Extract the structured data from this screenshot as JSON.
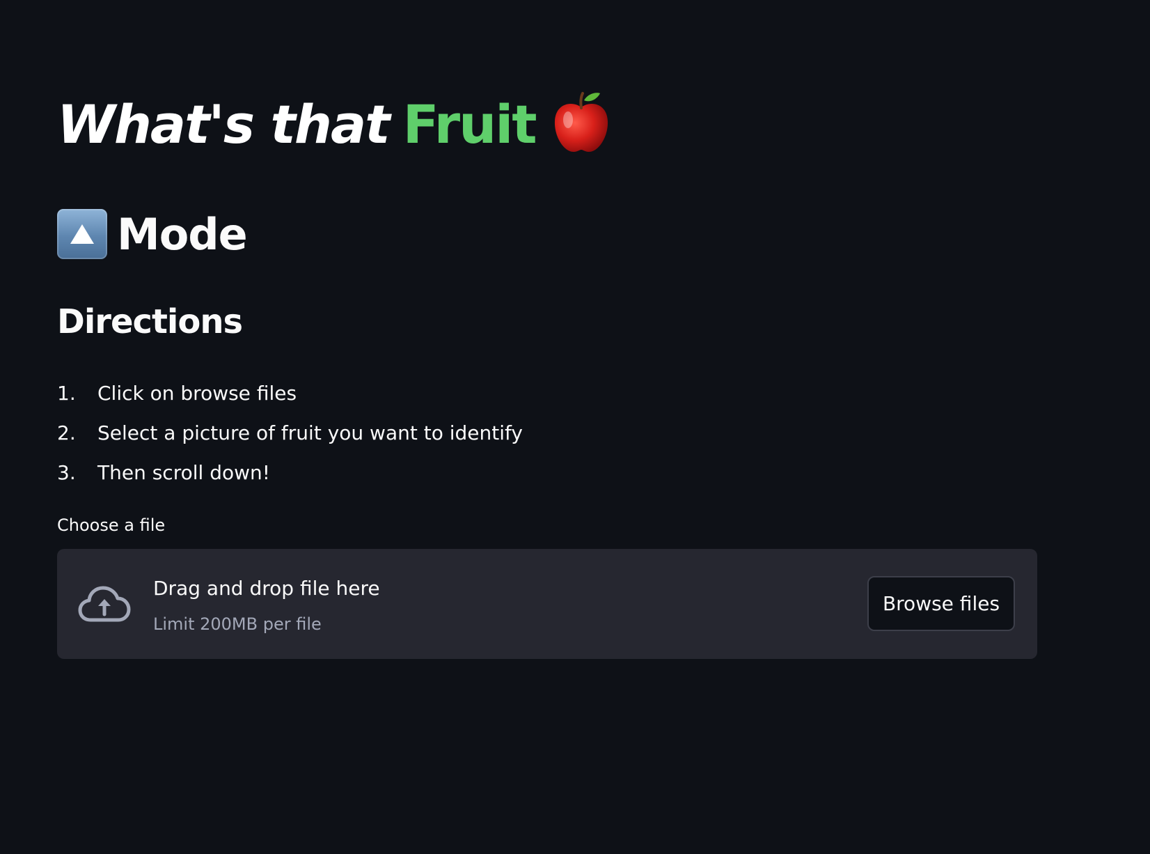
{
  "title": {
    "italic_part": "What's that",
    "accent_part": "Fruit",
    "emoji_icon": "apple-icon",
    "accent_color": "#5fcf6b"
  },
  "mode": {
    "icon": "up-arrow-button-icon",
    "label": "Mode"
  },
  "directions": {
    "heading": "Directions",
    "steps": [
      {
        "num": "1.",
        "text": "Click on browse files"
      },
      {
        "num": "2.",
        "text": "Select a picture of fruit you want to identify"
      },
      {
        "num": "3.",
        "text": "Then scroll down!"
      }
    ]
  },
  "uploader": {
    "label": "Choose a file",
    "drop_text": "Drag and drop file here",
    "limit_text": "Limit 200MB per file",
    "browse_label": "Browse files",
    "icon": "cloud-upload-icon"
  },
  "colors": {
    "background": "#0e1117",
    "dropzone": "#262730",
    "text": "#fafafa",
    "muted": "#a3a8b8"
  }
}
